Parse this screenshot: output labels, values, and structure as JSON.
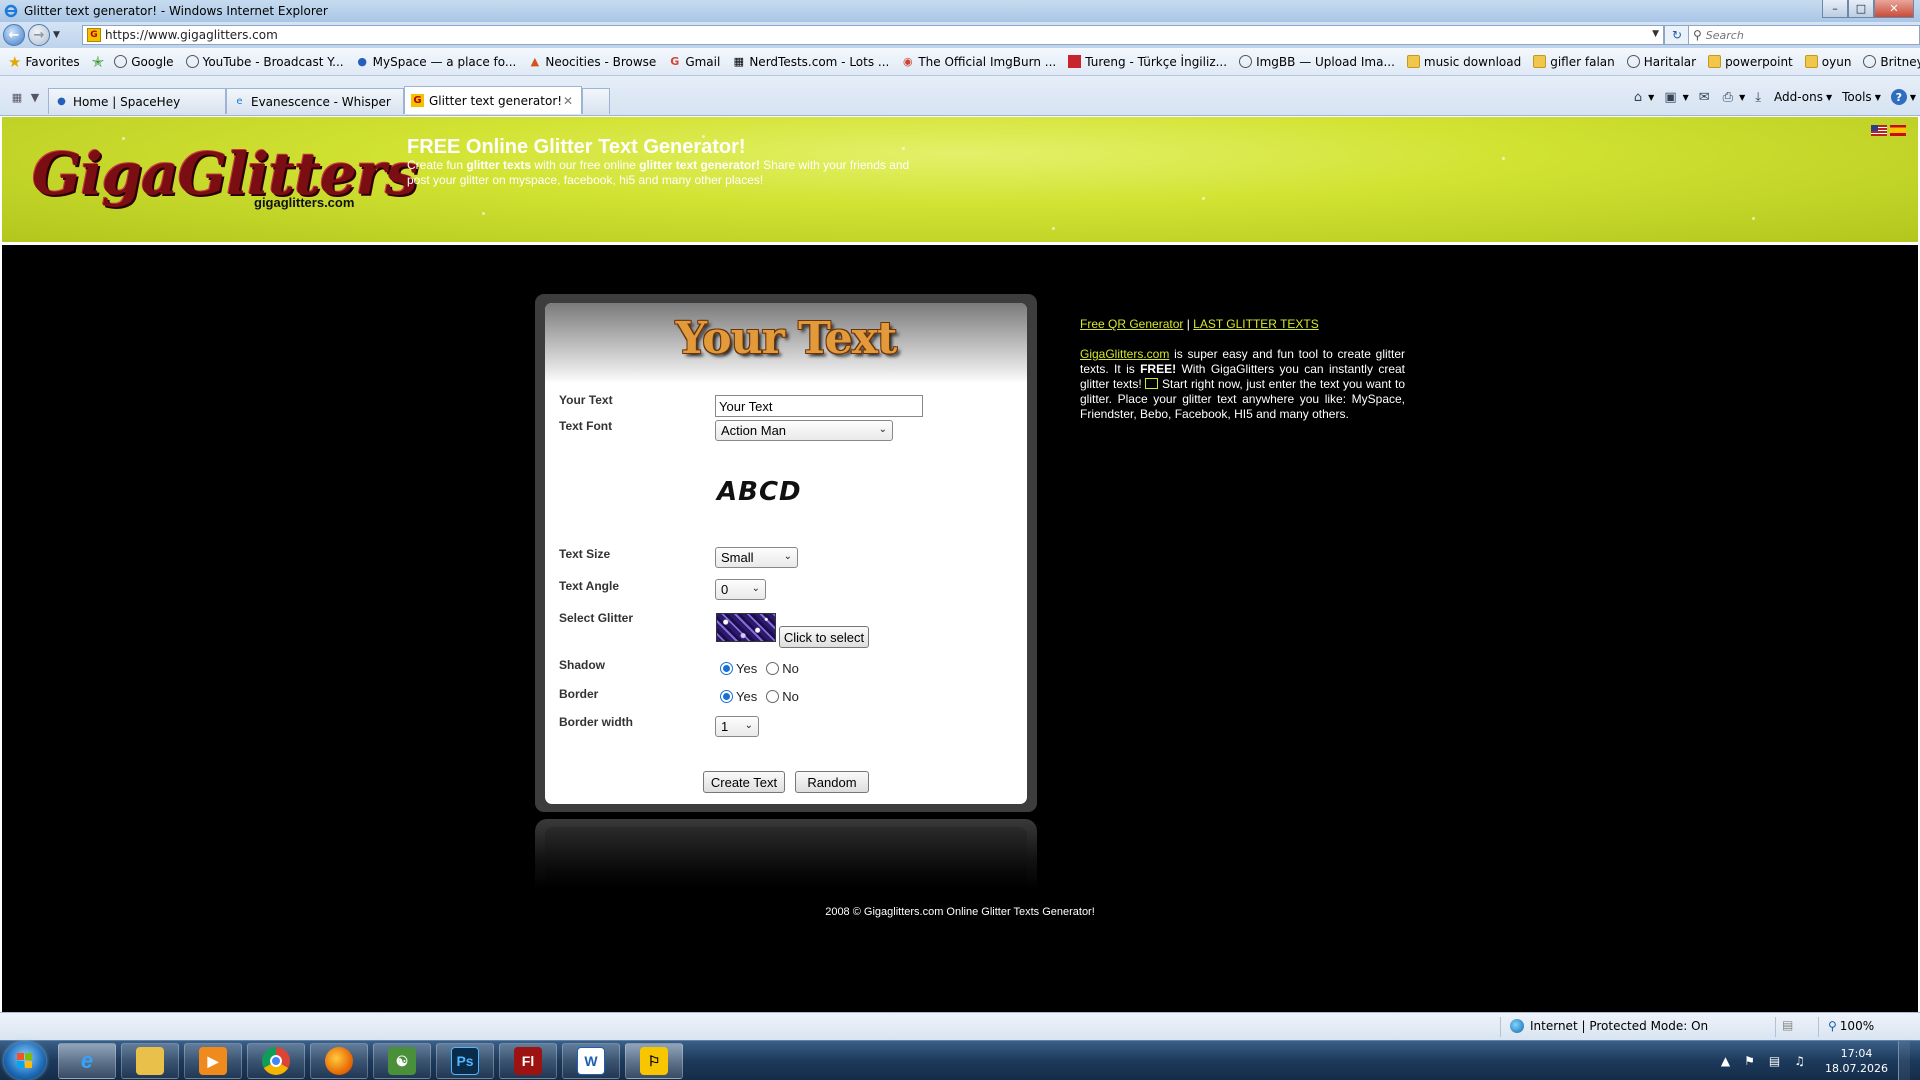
{
  "window": {
    "title": "Glitter text generator! - Windows Internet Explorer"
  },
  "address_bar": {
    "url": "https://www.gigaglitters.com",
    "search_placeholder": "Search"
  },
  "favorites": {
    "label": "Favorites",
    "items": [
      {
        "label": "Google",
        "icon": "globe-icon"
      },
      {
        "label": "YouTube - Broadcast Y...",
        "icon": "globe-icon"
      },
      {
        "label": "MySpace — a place fo...",
        "icon": "myspace-icon"
      },
      {
        "label": "Neocities - Browse",
        "icon": "neocities-icon"
      },
      {
        "label": "Gmail",
        "icon": "google-icon"
      },
      {
        "label": "NerdTests.com - Lots ...",
        "icon": "nerdtests-icon"
      },
      {
        "label": "The Official ImgBurn ...",
        "icon": "imgburn-icon"
      },
      {
        "label": "Tureng - Türkçe İngiliz...",
        "icon": "tureng-icon"
      },
      {
        "label": "ImgBB — Upload Ima...",
        "icon": "globe-icon"
      },
      {
        "label": "music download",
        "icon": "folder-icon"
      },
      {
        "label": "gifler falan",
        "icon": "folder-icon"
      },
      {
        "label": "Haritalar",
        "icon": "globe-icon"
      },
      {
        "label": "powerpoint",
        "icon": "folder-icon"
      },
      {
        "label": "oyun",
        "icon": "folder-icon"
      },
      {
        "label": "Britney spears skins pa...",
        "icon": "globe-icon"
      }
    ]
  },
  "tabs": [
    {
      "label": "Home | SpaceHey",
      "icon": "spacehey-icon",
      "active": false
    },
    {
      "label": "Evanescence - Whisper",
      "icon": "ie-icon",
      "active": false
    },
    {
      "label": "Glitter text generator!",
      "icon": "gigaglitters-icon",
      "active": true
    }
  ],
  "command_bar": {
    "addons": "Add-ons",
    "tools": "Tools"
  },
  "site": {
    "logo": "GigaGlitters",
    "logo_domain": "gigaglitters.com",
    "title": "FREE Online Glitter Text Generator!",
    "desc_1": "Create fun ",
    "desc_b1": "glitter texts",
    "desc_2": " with our free online ",
    "desc_b2": "glitter text generator!",
    "desc_3": " Share with your friends and post your glitter on myspace, facebook, hi5 and many other places!"
  },
  "form": {
    "heading": "Your Text",
    "your_text_label": "Your Text",
    "your_text_value": "Your Text",
    "font_label": "Text Font",
    "font_value": "Action Man",
    "font_preview": "ABCD",
    "size_label": "Text Size",
    "size_value": "Small",
    "angle_label": "Text Angle",
    "angle_value": "0",
    "glitter_label": "Select Glitter",
    "glitter_button": "Click to select",
    "shadow_label": "Shadow",
    "shadow_value": "Yes",
    "border_label": "Border",
    "border_value": "Yes",
    "yes": "Yes",
    "no": "No",
    "border_width_label": "Border width",
    "border_width_value": "1",
    "create_button": "Create Text",
    "random_button": "Random"
  },
  "sidebar": {
    "qr_link": "Free QR Generator",
    "separator": " | ",
    "last_link": "LAST GLITTER TEXTS",
    "site_link": "GigaGlitters.com",
    "desc_1": " is super easy and fun tool to create glitter texts. It is ",
    "desc_free": "FREE!",
    "desc_2": " With GigaGlitters you can instantly creat glitter texts! ",
    "desc_3": " Start right now, just enter the text you want to glitter. Place your glitter text anywhere you like: MySpace, Friendster, Bebo, Facebook, HI5 and many others."
  },
  "footer": "2008 © Gigaglitters.com Online Glitter Texts Generator!",
  "status": {
    "zone": "Internet | Protected Mode: On",
    "zoom": "100%"
  },
  "taskbar": {
    "apps": [
      "internet-explorer",
      "file-explorer",
      "media-player",
      "chrome",
      "firefox",
      "network-app",
      "photoshop",
      "flash",
      "word",
      "aim"
    ],
    "clock_time": "17:04",
    "clock_date": "18.07.2026"
  }
}
